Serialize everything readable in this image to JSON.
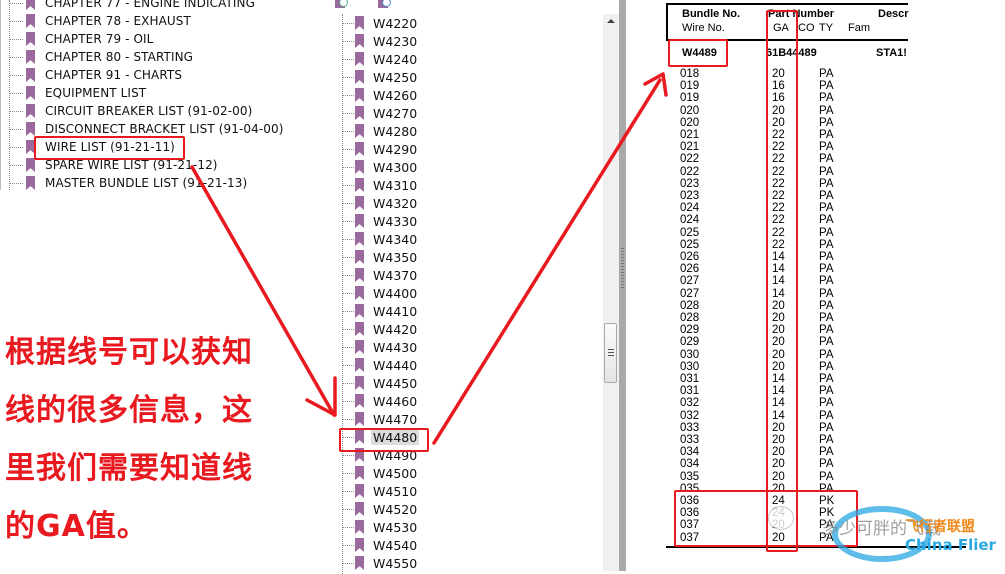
{
  "left_tree": {
    "items": [
      {
        "label": "CHAPTER 77 - ENGINE INDICATING"
      },
      {
        "label": "CHAPTER 78 - EXHAUST"
      },
      {
        "label": "CHAPTER 79 - OIL"
      },
      {
        "label": "CHAPTER 80 - STARTING"
      },
      {
        "label": "CHAPTER 91 - CHARTS"
      },
      {
        "label": "EQUIPMENT LIST"
      },
      {
        "label": "CIRCUIT BREAKER LIST (91-02-00)"
      },
      {
        "label": "DISCONNECT BRACKET LIST (91-04-00)"
      },
      {
        "label": "WIRE LIST (91-21-11)"
      },
      {
        "label": "SPARE WIRE LIST (91-21-12)"
      },
      {
        "label": "MASTER BUNDLE LIST (91-21-13)"
      }
    ]
  },
  "mid_tree": {
    "toolbar_icons": [
      "expand-bookmark-icon",
      "bookmark-options-icon"
    ],
    "selected": "W4480",
    "items": [
      {
        "label": "W4220"
      },
      {
        "label": "W4230"
      },
      {
        "label": "W4240"
      },
      {
        "label": "W4250"
      },
      {
        "label": "W4260"
      },
      {
        "label": "W4270"
      },
      {
        "label": "W4280"
      },
      {
        "label": "W4290"
      },
      {
        "label": "W4300"
      },
      {
        "label": "W4310"
      },
      {
        "label": "W4320"
      },
      {
        "label": "W4330"
      },
      {
        "label": "W4340"
      },
      {
        "label": "W4350"
      },
      {
        "label": "W4370"
      },
      {
        "label": "W4400"
      },
      {
        "label": "W4410"
      },
      {
        "label": "W4420"
      },
      {
        "label": "W4430"
      },
      {
        "label": "W4440"
      },
      {
        "label": "W4450"
      },
      {
        "label": "W4460"
      },
      {
        "label": "W4470"
      },
      {
        "label": "W4480"
      },
      {
        "label": "W4490"
      },
      {
        "label": "W4500"
      },
      {
        "label": "W4510"
      },
      {
        "label": "W4520"
      },
      {
        "label": "W4530"
      },
      {
        "label": "W4540"
      },
      {
        "label": "W4550"
      }
    ]
  },
  "pdf": {
    "header": {
      "bundle_no": "Bundle No.",
      "wire_no": "Wire No.",
      "part_number": "Part Number",
      "ga": "GA",
      "co": "CO",
      "ty": "TY",
      "fam": "Fam",
      "description": "Descr"
    },
    "bundle": {
      "no": "W4489",
      "part_number": "61B44489",
      "description": "STA1!"
    },
    "rows": [
      {
        "wire": "018",
        "ga": "20",
        "ty": "PA"
      },
      {
        "wire": "019",
        "ga": "16",
        "ty": "PA"
      },
      {
        "wire": "019",
        "ga": "16",
        "ty": "PA"
      },
      {
        "wire": "020",
        "ga": "20",
        "ty": "PA"
      },
      {
        "wire": "020",
        "ga": "20",
        "ty": "PA"
      },
      {
        "wire": "021",
        "ga": "22",
        "ty": "PA"
      },
      {
        "wire": "021",
        "ga": "22",
        "ty": "PA"
      },
      {
        "wire": "022",
        "ga": "22",
        "ty": "PA"
      },
      {
        "wire": "022",
        "ga": "22",
        "ty": "PA"
      },
      {
        "wire": "023",
        "ga": "22",
        "ty": "PA"
      },
      {
        "wire": "023",
        "ga": "22",
        "ty": "PA"
      },
      {
        "wire": "024",
        "ga": "22",
        "ty": "PA"
      },
      {
        "wire": "024",
        "ga": "22",
        "ty": "PA"
      },
      {
        "wire": "025",
        "ga": "22",
        "ty": "PA"
      },
      {
        "wire": "025",
        "ga": "22",
        "ty": "PA"
      },
      {
        "wire": "026",
        "ga": "14",
        "ty": "PA"
      },
      {
        "wire": "026",
        "ga": "14",
        "ty": "PA"
      },
      {
        "wire": "027",
        "ga": "14",
        "ty": "PA"
      },
      {
        "wire": "027",
        "ga": "14",
        "ty": "PA"
      },
      {
        "wire": "028",
        "ga": "20",
        "ty": "PA"
      },
      {
        "wire": "028",
        "ga": "20",
        "ty": "PA"
      },
      {
        "wire": "029",
        "ga": "20",
        "ty": "PA"
      },
      {
        "wire": "029",
        "ga": "20",
        "ty": "PA"
      },
      {
        "wire": "030",
        "ga": "20",
        "ty": "PA"
      },
      {
        "wire": "030",
        "ga": "20",
        "ty": "PA"
      },
      {
        "wire": "031",
        "ga": "14",
        "ty": "PA"
      },
      {
        "wire": "031",
        "ga": "14",
        "ty": "PA"
      },
      {
        "wire": "032",
        "ga": "14",
        "ty": "PA"
      },
      {
        "wire": "032",
        "ga": "14",
        "ty": "PA"
      },
      {
        "wire": "033",
        "ga": "20",
        "ty": "PA"
      },
      {
        "wire": "033",
        "ga": "20",
        "ty": "PA"
      },
      {
        "wire": "034",
        "ga": "20",
        "ty": "PA"
      },
      {
        "wire": "034",
        "ga": "20",
        "ty": "PA"
      },
      {
        "wire": "035",
        "ga": "20",
        "ty": "PA"
      },
      {
        "wire": "035",
        "ga": "20",
        "ty": "PA"
      },
      {
        "wire": "036",
        "ga": "24",
        "ty": "PK"
      },
      {
        "wire": "036",
        "ga": "24",
        "ty": "PK"
      },
      {
        "wire": "037",
        "ga": "20",
        "ty": "PA"
      },
      {
        "wire": "037",
        "ga": "20",
        "ty": "PA"
      }
    ]
  },
  "annotation": {
    "note_lines": [
      "根据线号可以获知",
      "线的很多信息，这",
      "里我们需要知道线",
      "的GA值。"
    ],
    "color": "#e8191f"
  },
  "watermark": {
    "cn_text": "多少可胖的飞载",
    "brand_cn": "飞行者联盟",
    "brand_en": "China Flier"
  }
}
